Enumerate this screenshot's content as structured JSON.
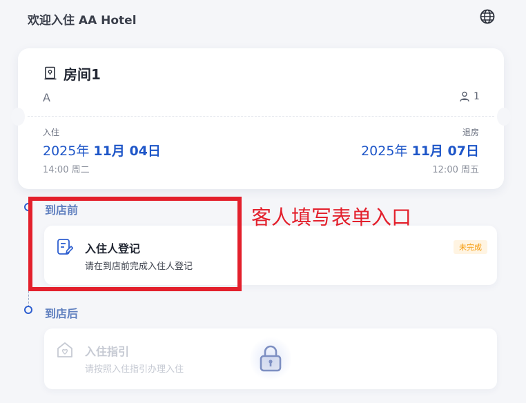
{
  "header": {
    "title": "欢迎入住 AA Hotel",
    "language_icon": "globe-icon"
  },
  "room": {
    "name": "房间1",
    "type": "A",
    "guest_count": "1",
    "checkin": {
      "label": "入住",
      "year": "2025年",
      "date": "11月 04日",
      "time": "14:00 周二"
    },
    "checkout": {
      "label": "退房",
      "year": "2025年",
      "date": "11月 07日",
      "time": "12:00 周五"
    }
  },
  "stages": {
    "before": {
      "label": "到店前",
      "task": {
        "title": "入住人登记",
        "subtitle": "请在到店前完成入住人登记",
        "status": "未完成"
      }
    },
    "after": {
      "label": "到店后",
      "task": {
        "title": "入住指引",
        "subtitle": "请按照入住指引办理入住",
        "locked": true
      }
    }
  },
  "annotation": {
    "text": "客人填写表单入口"
  },
  "colors": {
    "accent": "#1e56c8",
    "status_pending": "#f59b0c",
    "annotation": "#e3202c",
    "background": "#f5f6f9"
  }
}
